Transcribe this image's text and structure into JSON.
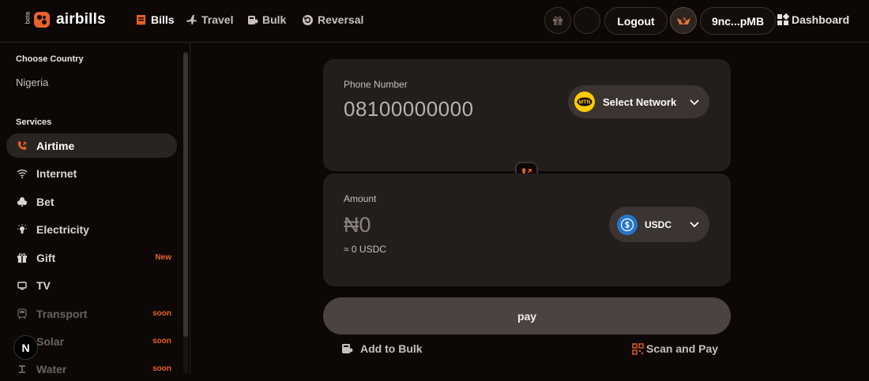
{
  "brand": {
    "beta": "beta",
    "name": "airbills"
  },
  "nav": {
    "bills": "Bills",
    "travel": "Travel",
    "bulk": "Bulk",
    "reversal": "Reversal"
  },
  "header": {
    "logout": "Logout",
    "wallet_address": "9nc...pMB",
    "dashboard": "Dashboard"
  },
  "sidebar": {
    "country_title": "Choose Country",
    "country_value": "Nigeria",
    "services_title": "Services",
    "items": [
      {
        "label": "Airtime",
        "icon": "phone-icon",
        "active": true,
        "tag": ""
      },
      {
        "label": "Internet",
        "icon": "wifi-icon",
        "tag": ""
      },
      {
        "label": "Bet",
        "icon": "club-icon",
        "tag": ""
      },
      {
        "label": "Electricity",
        "icon": "bulb-icon",
        "tag": ""
      },
      {
        "label": "Gift",
        "icon": "gift-icon",
        "tag": "New"
      },
      {
        "label": "TV",
        "icon": "tv-icon",
        "tag": ""
      },
      {
        "label": "Transport",
        "icon": "bus-icon",
        "tag": "soon",
        "disabled": true
      },
      {
        "label": "Solar",
        "icon": "sun-icon",
        "tag": "soon",
        "disabled": true
      },
      {
        "label": "Water",
        "icon": "water-icon",
        "tag": "soon",
        "disabled": true
      }
    ],
    "badge": "N"
  },
  "form": {
    "phone_label": "Phone Number",
    "phone_placeholder": "08100000000",
    "network_label": "Select Network",
    "network_logo_text": "MTN",
    "amount_label": "Amount",
    "amount_value": "₦0",
    "approx": "≈ 0 USDC",
    "currency": "USDC",
    "pay": "pay",
    "add_to_bulk": "Add to Bulk",
    "scan_and_pay": "Scan and Pay"
  },
  "colors": {
    "accent": "#e8622a",
    "background": "#0d0806",
    "card": "#231e1c"
  }
}
